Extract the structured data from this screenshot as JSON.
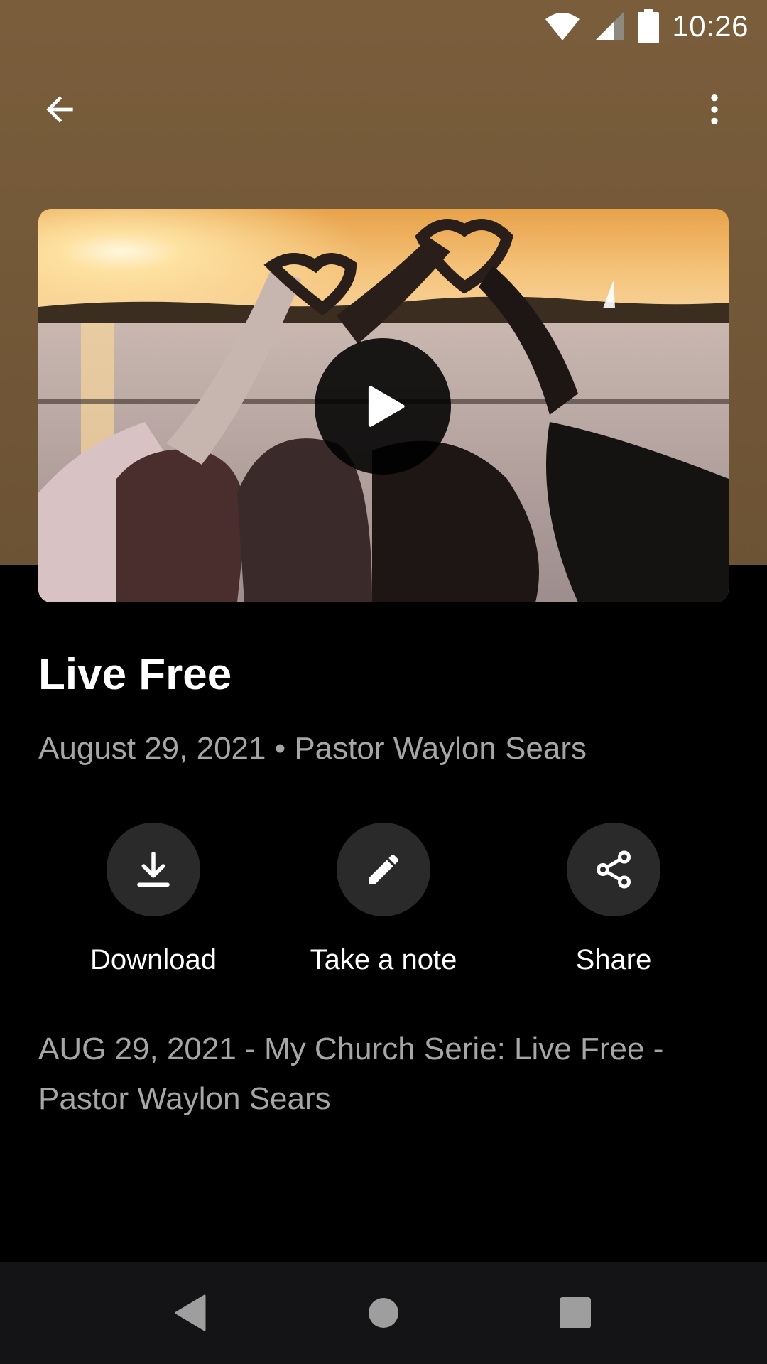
{
  "status_bar": {
    "time": "10:26"
  },
  "app_bar": {
    "back_icon": "arrow-left-icon",
    "more_icon": "more-vertical-icon"
  },
  "media": {
    "thumbnail": "sunset-hands-heart-image",
    "play_icon": "play-icon"
  },
  "sermon": {
    "title": "Live Free",
    "meta": "August 29, 2021 • Pastor Waylon Sears",
    "description": "AUG 29, 2021 - My Church Serie: Live Free - Pastor Waylon Sears"
  },
  "actions": [
    {
      "label": "Download",
      "icon": "download-icon"
    },
    {
      "label": "Take a note",
      "icon": "pencil-icon"
    },
    {
      "label": "Share",
      "icon": "share-icon"
    }
  ],
  "colors": {
    "header_bg": "#7a5e3c",
    "background": "#000000",
    "secondary_text": "#a6a6a6",
    "button_bg": "#2a2a2a",
    "nav_bar": "#141416"
  }
}
